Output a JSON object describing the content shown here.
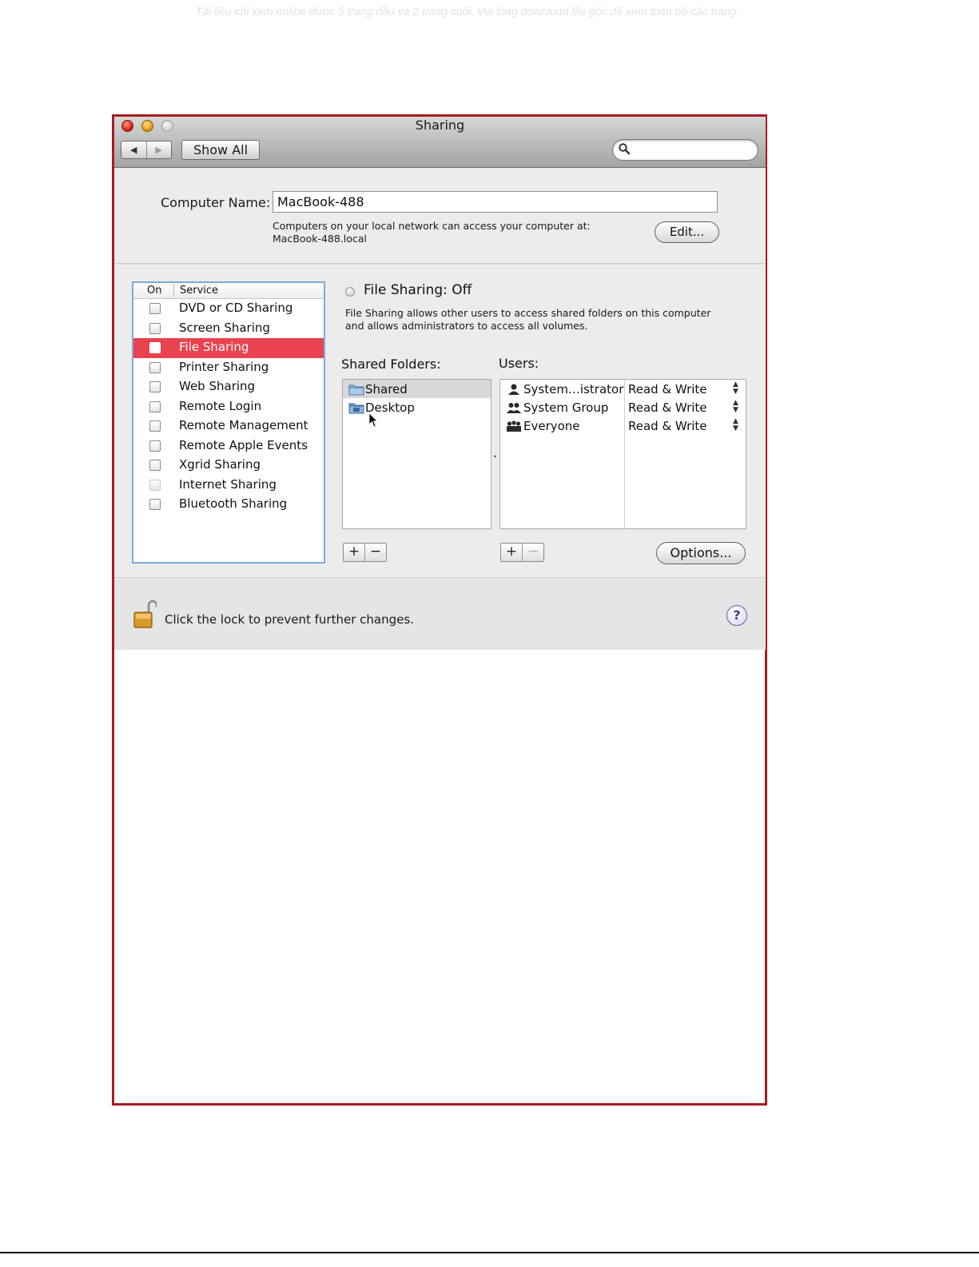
{
  "watermark": "Tài liệu chỉ xem online được 5 trang đầu và 2 trang cuối. Vui lòng download file gốc để xem toàn bộ các trang.",
  "window": {
    "title": "Sharing",
    "show_all_label": "Show All",
    "search_placeholder": ""
  },
  "computer_name": {
    "label": "Computer Name:",
    "value": "MacBook-488",
    "help_line1": "Computers on your local network can access your computer at:",
    "help_line2": "MacBook-488.local",
    "edit_label": "Edit..."
  },
  "services": {
    "col_on": "On",
    "col_service": "Service",
    "items": [
      {
        "label": "DVD or CD Sharing",
        "checked": false
      },
      {
        "label": "Screen Sharing",
        "checked": false
      },
      {
        "label": "File Sharing",
        "checked": false,
        "selected": true
      },
      {
        "label": "Printer Sharing",
        "checked": false
      },
      {
        "label": "Web Sharing",
        "checked": false
      },
      {
        "label": "Remote Login",
        "checked": false
      },
      {
        "label": "Remote Management",
        "checked": false
      },
      {
        "label": "Remote Apple Events",
        "checked": false
      },
      {
        "label": "Xgrid Sharing",
        "checked": false
      },
      {
        "label": "Internet Sharing",
        "checked": false,
        "disabled": true
      },
      {
        "label": "Bluetooth Sharing",
        "checked": false
      }
    ]
  },
  "detail": {
    "status": "File Sharing: Off",
    "description_line1": "File Sharing allows other users to access shared folders on this computer",
    "description_line2": "and allows administrators to access all volumes.",
    "shared_folders_label": "Shared Folders:",
    "users_label": "Users:",
    "folders": [
      {
        "name": "Shared",
        "selected": true
      },
      {
        "name": "Desktop",
        "selected": false
      }
    ],
    "users": [
      {
        "name": "System…istrator",
        "permission": "Read & Write",
        "icon": "single-user-icon"
      },
      {
        "name": "System Group",
        "permission": "Read & Write",
        "icon": "group-icon"
      },
      {
        "name": "Everyone",
        "permission": "Read & Write",
        "icon": "everyone-icon"
      }
    ],
    "add_label": "+",
    "remove_label": "−",
    "options_label": "Options..."
  },
  "footer": {
    "lock_text": "Click the lock to prevent further changes.",
    "help_label": "?"
  },
  "colors": {
    "selection": "#e8434f",
    "frame_border": "#a51c24",
    "panel_focus": "#7fa8dc"
  }
}
